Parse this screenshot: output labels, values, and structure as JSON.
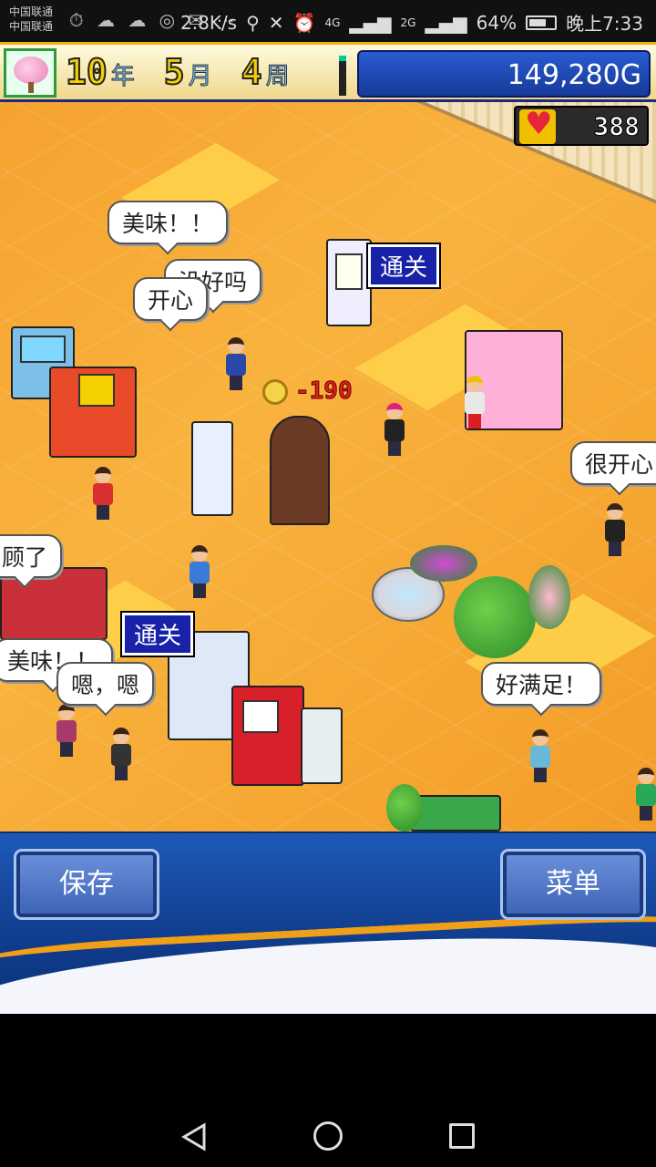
{
  "status_bar": {
    "carrier1": "中国联通",
    "carrier2": "中国联通",
    "left_icons": "⏱ ☁ ☁ ◎ ✉ ⋯",
    "speed": "2.8K/s",
    "signal1": "4G",
    "signal2": "2G",
    "battery_pct": "64%",
    "time": "晚上7:33"
  },
  "hud": {
    "year_num": "10",
    "year_unit": "年",
    "month_num": "5",
    "month_unit": "月",
    "week_num": "4",
    "week_unit": "周",
    "money": "149,280G",
    "hearts": "388"
  },
  "scene": {
    "bubbles": [
      "美味！！",
      "没好吗",
      "开心",
      "很开心",
      "顾了",
      "美味！！",
      "嗯，嗯",
      "好满足！"
    ],
    "clear_tags": [
      "通关",
      "通关"
    ],
    "score_pop": "-190"
  },
  "buttons": {
    "save": "保存",
    "menu": "菜单"
  },
  "colors": {
    "floor": "#f6a230",
    "hud_blue": "#1e58b8",
    "tag_blue": "#1822a8",
    "accent_orange": "#f0a018"
  }
}
